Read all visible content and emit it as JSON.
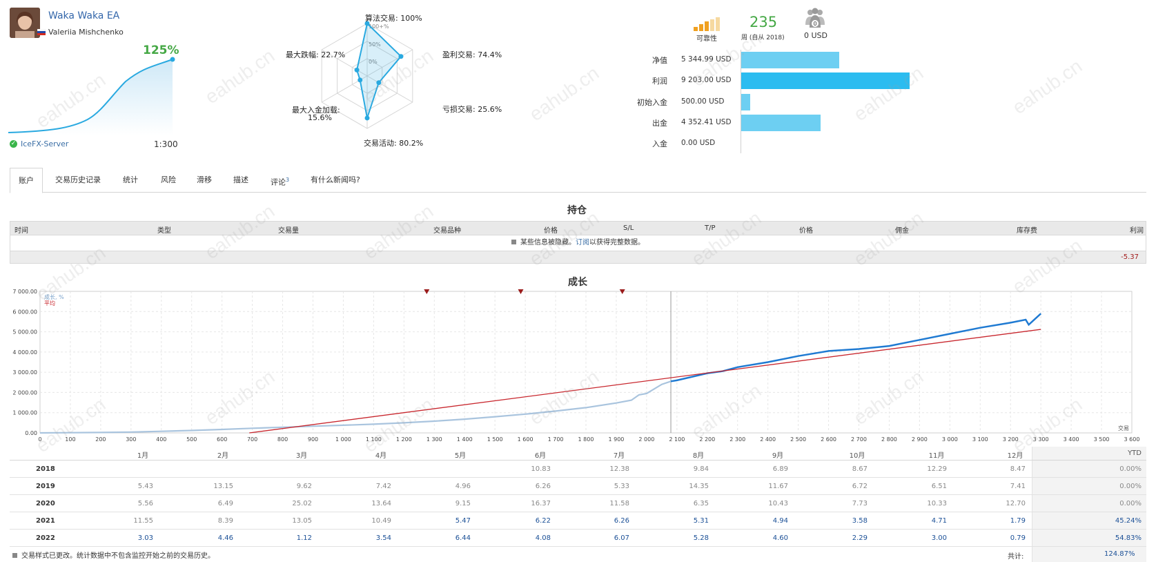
{
  "header": {
    "ea_name": "Waka Waka EA",
    "author": "Valeriia Mishchenko",
    "growth": "125%",
    "server": "IceFX-Server",
    "leverage": "1:300"
  },
  "radar": {
    "axes": [
      {
        "label": "算法交易: 100%",
        "value": 100
      },
      {
        "label": "盈利交易: 74.4%",
        "value": 74.4
      },
      {
        "label": "亏损交易: 25.6%",
        "value": 25.6
      },
      {
        "label": "交易活动: 80.2%",
        "value": 80.2
      },
      {
        "label": "最大入金加载:",
        "label2": "15.6%",
        "value": 15.6
      },
      {
        "label": "最大跌幅: 22.7%",
        "value": 22.7
      }
    ],
    "ring_labels": [
      "100+%",
      "50%",
      "0%"
    ]
  },
  "stats": {
    "reliability_label": "可靠性",
    "weeks": "235",
    "weeks_label": "周 (自从 2018)",
    "subscribers": "0",
    "subs_label": "0 USD"
  },
  "money": [
    {
      "label": "净值",
      "value": "5 344.99 USD",
      "amount": 5344.99
    },
    {
      "label": "利润",
      "value": "9 203.00 USD",
      "amount": 9203.0
    },
    {
      "label": "初始入金",
      "value": "500.00 USD",
      "amount": 500.0
    },
    {
      "label": "出金",
      "value": "4 352.41 USD",
      "amount": 4352.41
    },
    {
      "label": "入金",
      "value": "0.00 USD",
      "amount": 0
    }
  ],
  "tabs": [
    {
      "label": "账户",
      "active": true
    },
    {
      "label": "交易历史记录"
    },
    {
      "label": "统计"
    },
    {
      "label": "风险"
    },
    {
      "label": "滑移"
    },
    {
      "label": "描述"
    },
    {
      "label": "评论",
      "sup": "3"
    },
    {
      "label": "有什么新闻吗?"
    }
  ],
  "positions": {
    "title": "持仓",
    "columns": [
      "时间",
      "类型",
      "交易量",
      "交易品种",
      "价格",
      "S/L",
      "T/P",
      "价格",
      "佣金",
      "库存费",
      "利润"
    ],
    "note_before": "某些信息被隐藏。",
    "note_link": "订阅",
    "note_after": "以获得完整数据。",
    "total": "-5.37"
  },
  "chart_data": {
    "type": "line",
    "title": "成长",
    "xlabel": "交易",
    "ylabel": "",
    "xlim": [
      0,
      3600
    ],
    "ylim": [
      0,
      7000
    ],
    "xticks": [
      "0",
      "100",
      "200",
      "300",
      "400",
      "500",
      "600",
      "700",
      "800",
      "900",
      "1 000",
      "1 100",
      "1 200",
      "1 300",
      "1 400",
      "1 500",
      "1 600",
      "1 700",
      "1 800",
      "1 900",
      "2 000",
      "2 100",
      "2 200",
      "2 300",
      "2 400",
      "2 500",
      "2 600",
      "2 700",
      "2 800",
      "2 900",
      "3 000",
      "3 100",
      "3 200",
      "3 300",
      "3 400",
      "3 500",
      "3 600"
    ],
    "yticks": [
      "0.00",
      "1 000.00",
      "2 000.00",
      "3 000.00",
      "4 000.00",
      "5 000.00",
      "6 000.00",
      "7 000.00"
    ],
    "legend": [
      "成长, %",
      "平均"
    ],
    "legend_colors": [
      "#7aa3cc",
      "#c8262d"
    ],
    "grid": true,
    "divider_x": 2080,
    "event_markers_x": [
      1275,
      1585,
      1920
    ],
    "series": [
      {
        "name": "成长, %",
        "color_early": "#a9c4de",
        "color_late": "#1f7ad2",
        "x": [
          0,
          100,
          200,
          300,
          400,
          500,
          600,
          700,
          800,
          900,
          1000,
          1100,
          1200,
          1300,
          1400,
          1500,
          1600,
          1700,
          1800,
          1900,
          1950,
          1975,
          2000,
          2050,
          2080,
          2100,
          2200,
          2250,
          2300,
          2400,
          2500,
          2600,
          2700,
          2800,
          2900,
          3000,
          3100,
          3200,
          3250,
          3260,
          3300
        ],
        "y": [
          0,
          10,
          20,
          40,
          80,
          120,
          170,
          230,
          280,
          330,
          380,
          430,
          500,
          580,
          680,
          800,
          930,
          1080,
          1250,
          1480,
          1620,
          1880,
          1950,
          2400,
          2550,
          2600,
          2950,
          3050,
          3250,
          3500,
          3800,
          4050,
          4150,
          4300,
          4600,
          4900,
          5200,
          5450,
          5600,
          5350,
          5900
        ]
      },
      {
        "name": "平均",
        "color": "#c8262d",
        "x": [
          690,
          3300
        ],
        "y": [
          0,
          5120
        ]
      }
    ]
  },
  "monthly": {
    "months": [
      "1月",
      "2月",
      "3月",
      "4月",
      "5月",
      "6月",
      "7月",
      "8月",
      "9月",
      "10月",
      "11月",
      "12月"
    ],
    "ytd_label": "YTD",
    "rows": [
      {
        "year": "2018",
        "values": [
          "",
          "",
          "",
          "",
          "",
          "10.83",
          "12.38",
          "9.84",
          "6.89",
          "8.67",
          "12.29",
          "8.47"
        ],
        "ytd": "0.00%",
        "style": "gray"
      },
      {
        "year": "2019",
        "values": [
          "5.43",
          "13.15",
          "9.62",
          "7.42",
          "4.96",
          "6.26",
          "5.33",
          "14.35",
          "11.67",
          "6.72",
          "6.51",
          "7.41"
        ],
        "ytd": "0.00%",
        "style": "gray"
      },
      {
        "year": "2020",
        "values": [
          "5.56",
          "6.49",
          "25.02",
          "13.64",
          "9.15",
          "16.37",
          "11.58",
          "6.35",
          "10.43",
          "7.73",
          "10.33",
          "12.70"
        ],
        "ytd": "0.00%",
        "style": "gray"
      },
      {
        "year": "2021",
        "values": [
          "11.55",
          "8.39",
          "13.05",
          "10.49",
          "5.47",
          "6.22",
          "6.26",
          "5.31",
          "4.94",
          "3.58",
          "4.71",
          "1.79"
        ],
        "ytd": "45.24%",
        "style": "mixed2021"
      },
      {
        "year": "2022",
        "values": [
          "3.03",
          "4.46",
          "1.12",
          "3.54",
          "6.44",
          "4.08",
          "6.07",
          "5.28",
          "4.60",
          "2.29",
          "3.00",
          "0.79"
        ],
        "ytd": "54.83%",
        "style": "blue"
      }
    ],
    "footnote": "交易样式已更改。统计数据中不包含监控开始之前的交易历史。",
    "total_label": "共计:",
    "total_value": "124.87%"
  },
  "watermark": "eahub.cn"
}
